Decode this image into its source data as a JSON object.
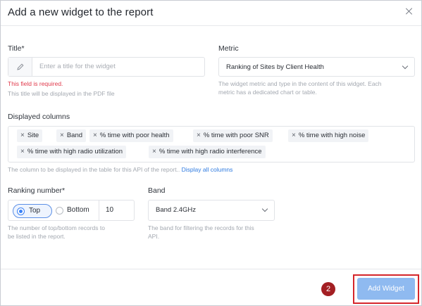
{
  "dialog": {
    "title": "Add a new widget to the report"
  },
  "title_field": {
    "label": "Title*",
    "placeholder": "Enter a title for the widget",
    "error": "This field is required.",
    "help": "This title will be displayed in the PDF file"
  },
  "metric_field": {
    "label": "Metric",
    "value": "Ranking of Sites by Client Health",
    "help_line1": "The widget metric and type in the content of this widget. Each",
    "help_line2": "metric has a dedicated chart or table."
  },
  "columns_field": {
    "label": "Displayed columns",
    "chips": [
      "Site",
      "Band",
      "% time with poor health",
      "% time with poor SNR",
      "% time with high noise",
      "% time with high radio utilization",
      "% time with high radio interference"
    ],
    "help": "The column to be displayed in the table for this API of the report..",
    "link": "Display all columns"
  },
  "ranking_field": {
    "label": "Ranking number*",
    "option_top": "Top",
    "option_bottom": "Bottom",
    "value": "10",
    "help_line1": "The number of top/bottom records to",
    "help_line2": "be listed in the report."
  },
  "band_field": {
    "label": "Band",
    "value": "Band 2.4GHz",
    "help_line1": "The band for filtering the records for this",
    "help_line2": "API."
  },
  "footer": {
    "step_badge": "2",
    "add_button": "Add Widget"
  },
  "colors": {
    "accent": "#3b82f6",
    "button_bg": "#8fbaf0",
    "error": "#e0394b",
    "highlight": "#d5262b",
    "badge": "#a31f23"
  }
}
